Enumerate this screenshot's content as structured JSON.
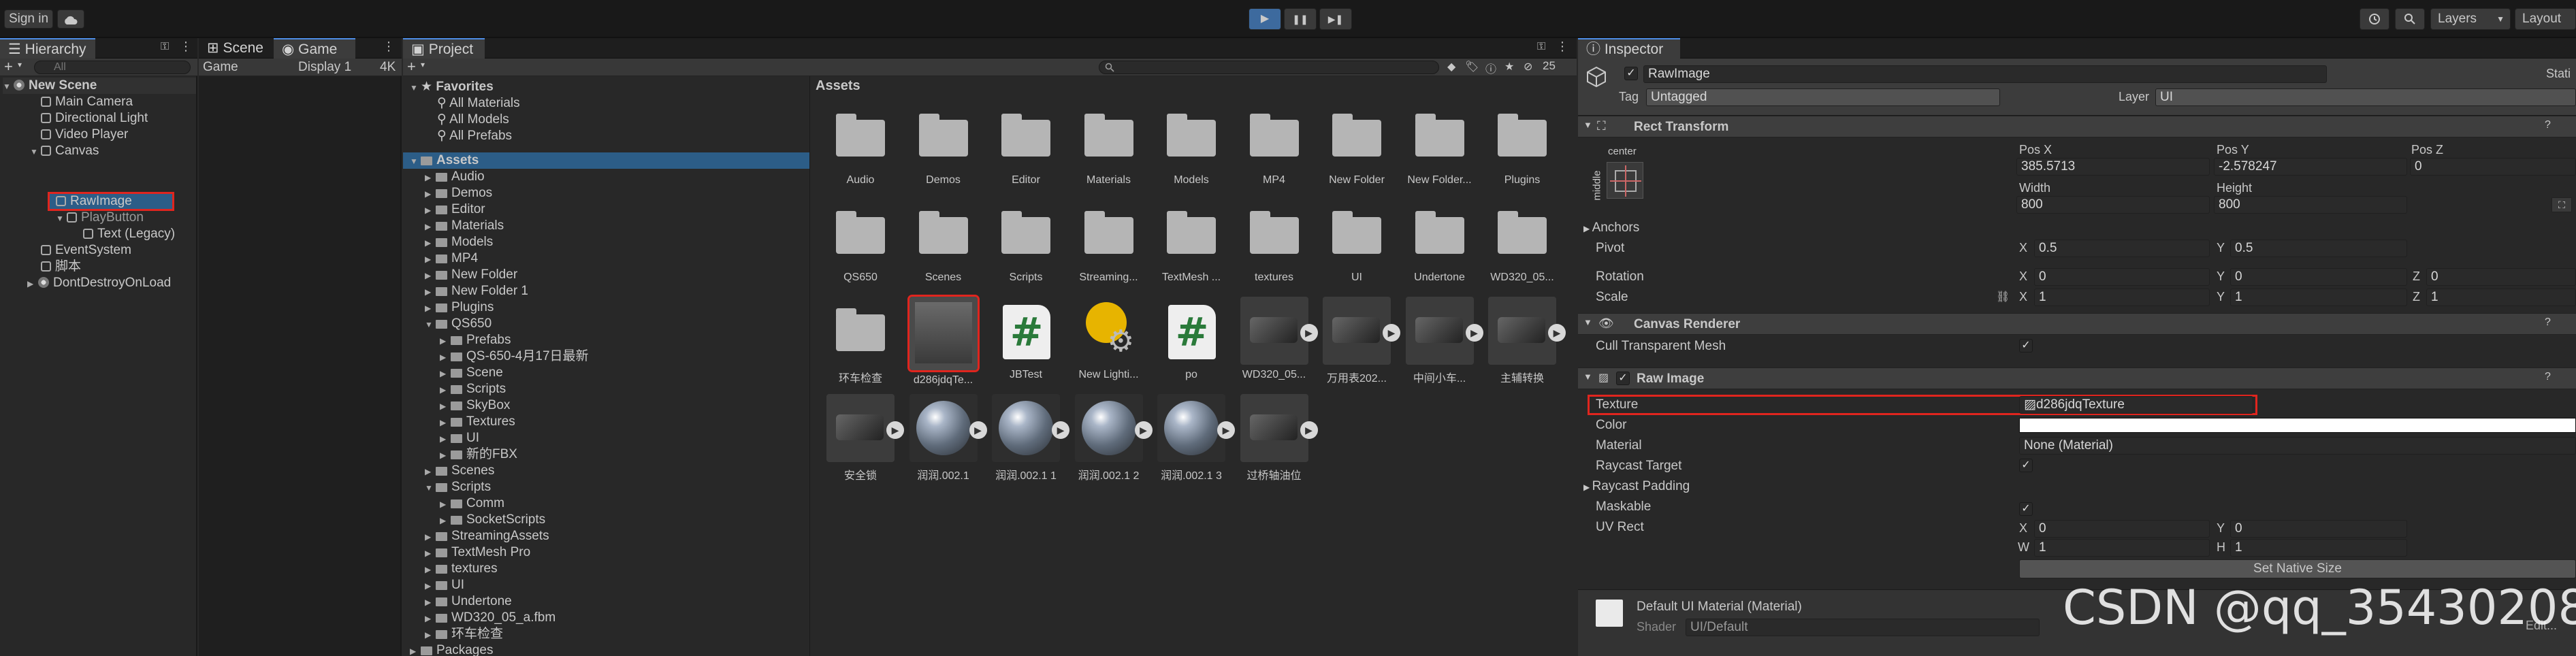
{
  "toolbar": {
    "sign_in": "Sign in",
    "cloud_icon": "cloud-icon",
    "play_icon": "▶",
    "pause_icon": "❚❚",
    "step_icon": "▶❚",
    "history_icon": "history-icon",
    "search_icon": "search-icon",
    "layers_label": "Layers",
    "layout_label": "Layout"
  },
  "hierarchy": {
    "tab": "Hierarchy",
    "add": "+",
    "search_placeholder": "All",
    "items": [
      {
        "label": "New Scene",
        "type": "scene"
      },
      {
        "label": "Main Camera"
      },
      {
        "label": "Directional Light"
      },
      {
        "label": "Video Player"
      },
      {
        "label": "Canvas"
      },
      {
        "label": "RawImage"
      },
      {
        "label": "PlayButton"
      },
      {
        "label": "Text (Legacy)"
      },
      {
        "label": "EventSystem"
      },
      {
        "label": "脚本"
      },
      {
        "label": "DontDestroyOnLoad"
      }
    ]
  },
  "scene_game": {
    "tab_scene": "Scene",
    "tab_game": "Game",
    "game_dropdown": "Game",
    "display_dropdown": "Display 1",
    "res": "4K"
  },
  "project": {
    "tab": "Project",
    "add": "+",
    "count": "25",
    "favorites_label": "Favorites",
    "favorites": [
      "All Materials",
      "All Models",
      "All Prefabs"
    ],
    "tree": [
      "Assets",
      "Audio",
      "Demos",
      "Editor",
      "Materials",
      "Models",
      "MP4",
      "New Folder",
      "New Folder 1",
      "Plugins",
      "QS650",
      "Prefabs",
      "QS-650-4月17日最新",
      "Scene",
      "Scripts",
      "SkyBox",
      "Textures",
      "UI",
      "新的FBX",
      "Scenes",
      "Scripts",
      "Comm",
      "SocketScripts",
      "StreamingAssets",
      "TextMesh Pro",
      "textures",
      "UI",
      "Undertone",
      "WD320_05_a.fbm",
      "环车检查",
      "Packages"
    ],
    "breadcrumb": "Assets",
    "grid": [
      {
        "label": "Audio",
        "kind": "folder"
      },
      {
        "label": "Demos",
        "kind": "folder"
      },
      {
        "label": "Editor",
        "kind": "folder"
      },
      {
        "label": "Materials",
        "kind": "folder"
      },
      {
        "label": "Models",
        "kind": "folder"
      },
      {
        "label": "MP4",
        "kind": "folder"
      },
      {
        "label": "New Folder",
        "kind": "folder"
      },
      {
        "label": "New Folder...",
        "kind": "folder"
      },
      {
        "label": "Plugins",
        "kind": "folder"
      },
      {
        "label": "QS650",
        "kind": "folder"
      },
      {
        "label": "Scenes",
        "kind": "folder"
      },
      {
        "label": "Scripts",
        "kind": "folder"
      },
      {
        "label": "Streaming...",
        "kind": "folder"
      },
      {
        "label": "TextMesh ...",
        "kind": "folder"
      },
      {
        "label": "textures",
        "kind": "folder"
      },
      {
        "label": "UI",
        "kind": "folder"
      },
      {
        "label": "Undertone",
        "kind": "folder"
      },
      {
        "label": "WD320_05...",
        "kind": "folder"
      },
      {
        "label": "环车检查",
        "kind": "folder"
      },
      {
        "label": "d286jdqTe...",
        "kind": "render"
      },
      {
        "label": "JBTest",
        "kind": "script"
      },
      {
        "label": "New Lighti...",
        "kind": "lighting"
      },
      {
        "label": "po",
        "kind": "script"
      },
      {
        "label": "WD320_05...",
        "kind": "model"
      },
      {
        "label": "万用表202...",
        "kind": "model"
      },
      {
        "label": "中间小车...",
        "kind": "model"
      },
      {
        "label": "主辅转换",
        "kind": "model"
      },
      {
        "label": "安全锁",
        "kind": "model"
      },
      {
        "label": "润润.002.1",
        "kind": "material"
      },
      {
        "label": "润润.002.1 1",
        "kind": "material"
      },
      {
        "label": "润润.002.1 2",
        "kind": "material"
      },
      {
        "label": "润润.002.1 3",
        "kind": "material"
      },
      {
        "label": "过桥轴油位",
        "kind": "model"
      }
    ]
  },
  "inspector": {
    "tab": "Inspector",
    "object_name": "RawImage",
    "static_label": "Stati",
    "tag_label": "Tag",
    "tag_value": "Untagged",
    "layer_label": "Layer",
    "layer_value": "UI",
    "rect_transform": {
      "title": "Rect Transform",
      "anchor_preset": "center",
      "side_label": "middle",
      "posx_label": "Pos X",
      "posx": "385.5713",
      "posy_label": "Pos Y",
      "posy": "-2.578247",
      "posz_label": "Pos Z",
      "posz": "0",
      "width_label": "Width",
      "width": "800",
      "height_label": "Height",
      "height": "800",
      "anchors": "Anchors",
      "pivot": "Pivot",
      "pivot_x": "0.5",
      "pivot_y": "0.5",
      "rotation": "Rotation",
      "rot_x": "0",
      "rot_y": "0",
      "rot_z": "0",
      "scale": "Scale",
      "scale_x": "1",
      "scale_y": "1",
      "scale_z": "1",
      "x": "X",
      "y": "Y",
      "z": "Z"
    },
    "canvas_renderer": {
      "title": "Canvas Renderer",
      "cull": "Cull Transparent Mesh"
    },
    "raw_image": {
      "title": "Raw Image",
      "texture_label": "Texture",
      "texture_value": "d286jdqTexture",
      "color_label": "Color",
      "material_label": "Material",
      "material_value": "None (Material)",
      "raycast_target": "Raycast Target",
      "raycast_padding": "Raycast Padding",
      "maskable": "Maskable",
      "uv_rect": "UV Rect",
      "uv_x": "0",
      "uv_y": "0",
      "uv_w": "1",
      "uv_h": "1",
      "w": "W",
      "h": "H",
      "set_native": "Set Native Size"
    },
    "material_footer": {
      "name": "Default UI Material (Material)",
      "shader_label": "Shader",
      "shader_value": "UI/Default",
      "edit": "Edit..."
    }
  },
  "watermark": "CSDN @qq_35430208",
  "colors": {
    "accent": "#4d8de6",
    "highlight": "#e0251e",
    "selected_row": "#2c5d87"
  }
}
